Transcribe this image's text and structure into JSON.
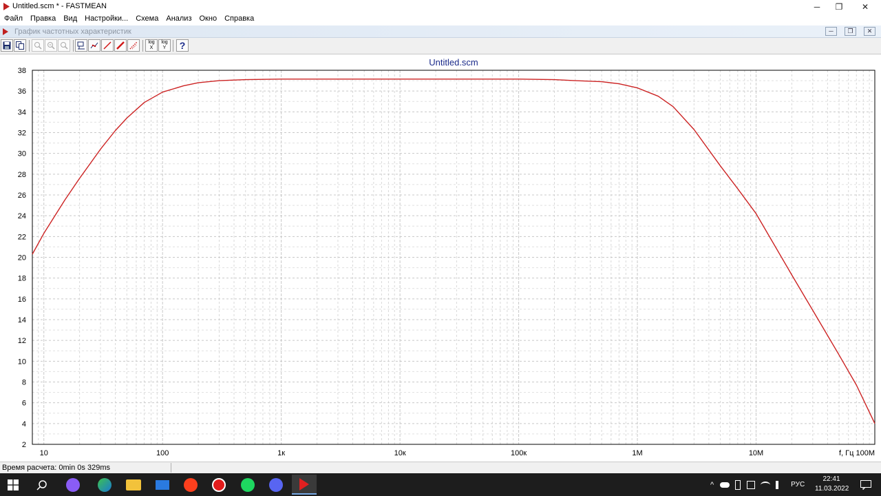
{
  "window": {
    "title": "Untitled.scm * - FASTMEAN",
    "min_glyph": "─",
    "max_glyph": "❐",
    "close_glyph": "✕"
  },
  "menu": [
    "Файл",
    "Правка",
    "Вид",
    "Настройки...",
    "Схема",
    "Анализ",
    "Окно",
    "Справка"
  ],
  "child_window": {
    "title": "График частотных характеристик",
    "btn_min": "─",
    "btn_restore": "❐",
    "btn_close": "✕"
  },
  "toolbar": {
    "save_icon": "save-icon",
    "copy_icon": "copy-icon",
    "zoom_icons": [
      "zoom-icon",
      "zoom-in-icon",
      "zoom-out-icon"
    ],
    "logx_label": "log",
    "logx_axis": "X",
    "logy_label": "log",
    "logy_axis": "Y",
    "help_label": "?"
  },
  "chart_data": {
    "type": "line",
    "title": "Untitled.scm",
    "xlabel": "f, Гц",
    "x_scale": "log",
    "xlim": [
      8,
      100000000
    ],
    "ylim": [
      2,
      38
    ],
    "yticks": [
      2,
      4,
      6,
      8,
      10,
      12,
      14,
      16,
      18,
      20,
      22,
      24,
      26,
      28,
      30,
      32,
      34,
      36,
      38
    ],
    "xticks": [
      {
        "value": 10,
        "label": "10"
      },
      {
        "value": 100,
        "label": "100"
      },
      {
        "value": 1000,
        "label": "1к"
      },
      {
        "value": 10000,
        "label": "10к"
      },
      {
        "value": 100000,
        "label": "100к"
      },
      {
        "value": 1000000,
        "label": "1M"
      },
      {
        "value": 10000000,
        "label": "10M"
      },
      {
        "value": 100000000,
        "label": "100M"
      }
    ],
    "grid": true,
    "line_color": "#cc2222",
    "series": [
      {
        "x": [
          8,
          10,
          15,
          20,
          30,
          40,
          50,
          70,
          100,
          150,
          200,
          300,
          500,
          1000,
          10000,
          100000,
          200000,
          300000,
          500000,
          700000,
          1000000,
          1500000,
          2000000,
          3000000,
          5000000,
          7000000,
          10000000,
          20000000,
          30000000,
          50000000,
          70000000,
          100000000
        ],
        "y": [
          20.3,
          22.3,
          25.5,
          27.6,
          30.4,
          32.2,
          33.4,
          34.9,
          35.9,
          36.5,
          36.8,
          37.0,
          37.1,
          37.15,
          37.15,
          37.15,
          37.1,
          37.0,
          36.9,
          36.7,
          36.3,
          35.5,
          34.5,
          32.3,
          28.8,
          26.6,
          24.2,
          18.3,
          14.9,
          10.6,
          7.7,
          4.0
        ]
      }
    ]
  },
  "status": {
    "text": "Время расчета: 0min 0s 329ms"
  },
  "taskbar": {
    "icons": [
      "windows-start-icon",
      "search-icon",
      "alice-icon",
      "edge-icon",
      "explorer-icon",
      "mail-icon",
      "yandex-icon",
      "yandex-browser-icon",
      "spotify-icon",
      "discord-icon",
      "fastmean-icon"
    ],
    "tray_icons": [
      "chevron-up-icon",
      "onedrive-icon",
      "usb-icon",
      "security-icon",
      "wifi-icon",
      "volume-icon"
    ],
    "lang": "РУС",
    "time": "22:41",
    "date": "11.03.2022"
  }
}
